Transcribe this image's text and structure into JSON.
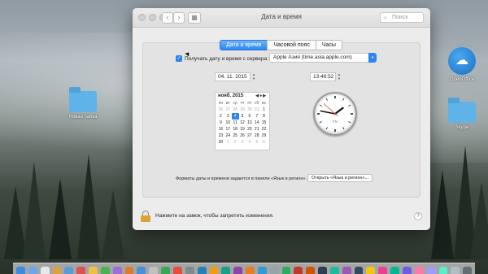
{
  "window": {
    "title": "Дата и время",
    "search_placeholder": "Поиск"
  },
  "tabs": [
    {
      "label": "Дата и время",
      "active": true
    },
    {
      "label": "Часовой пояс",
      "active": false
    },
    {
      "label": "Часы",
      "active": false
    }
  ],
  "server": {
    "checkbox_label": "Получать дату и время с сервера:",
    "checked": true,
    "selected": "Apple Азия (time.asia.apple.com)"
  },
  "date_field": "04. 11. 2015",
  "time_field": "13:46:52",
  "calendar": {
    "month_label": "нояб. 2015",
    "weekdays": [
      "пн",
      "вт",
      "ср",
      "чт",
      "пт",
      "сб",
      "вс"
    ],
    "days": [
      {
        "d": "26",
        "other": true
      },
      {
        "d": "27",
        "other": true
      },
      {
        "d": "28",
        "other": true
      },
      {
        "d": "29",
        "other": true
      },
      {
        "d": "30",
        "other": true
      },
      {
        "d": "31",
        "other": true
      },
      {
        "d": "1"
      },
      {
        "d": "2"
      },
      {
        "d": "3"
      },
      {
        "d": "4",
        "selected": true
      },
      {
        "d": "5"
      },
      {
        "d": "6"
      },
      {
        "d": "7"
      },
      {
        "d": "8"
      },
      {
        "d": "9"
      },
      {
        "d": "10"
      },
      {
        "d": "11"
      },
      {
        "d": "12"
      },
      {
        "d": "13"
      },
      {
        "d": "14"
      },
      {
        "d": "15"
      },
      {
        "d": "16"
      },
      {
        "d": "17"
      },
      {
        "d": "18"
      },
      {
        "d": "19"
      },
      {
        "d": "20"
      },
      {
        "d": "21"
      },
      {
        "d": "22"
      },
      {
        "d": "23"
      },
      {
        "d": "24"
      },
      {
        "d": "25"
      },
      {
        "d": "26"
      },
      {
        "d": "27"
      },
      {
        "d": "28"
      },
      {
        "d": "29"
      },
      {
        "d": "30"
      },
      {
        "d": "1",
        "other": true
      },
      {
        "d": "2",
        "other": true
      },
      {
        "d": "3",
        "other": true
      },
      {
        "d": "4",
        "other": true
      },
      {
        "d": "5",
        "other": true
      },
      {
        "d": "6",
        "other": true
      }
    ]
  },
  "clock": {
    "hour": 13,
    "minute": 46,
    "second": 52,
    "ampm_label": "PM"
  },
  "formats": {
    "text": "Форматы даты и времени задаются в панели «Язык и регион».",
    "button_label": "Открыть «Язык и регион»..."
  },
  "lock_text": "Нажмите на замок, чтобы запретить изменения.",
  "help_label": "?",
  "desktop": {
    "folder_label": "Новая папка",
    "openoffice_label": "OpenOffice",
    "skype_label": "Skype"
  },
  "colors": {
    "accent": "#2c86f2",
    "lock": "#d8a437"
  },
  "dock_colors": [
    "#3b8be0",
    "#6fa7e6",
    "#e8e8e8",
    "#e0a040",
    "#5b9bd5",
    "#d9534f",
    "#f0c040",
    "#4caf50",
    "#9c6fd6",
    "#e07a30",
    "#4a90d9",
    "#c0c0c0",
    "#3aa655",
    "#e74c3c",
    "#7f8c8d",
    "#2980b9",
    "#f39c12",
    "#16a085",
    "#8e44ad",
    "#e67e22",
    "#3498db",
    "#95a5a6",
    "#27ae60",
    "#c0392b",
    "#d35400",
    "#2c3e50",
    "#1abc9c",
    "#9b59b6",
    "#34495e",
    "#f1c40f",
    "#e84393",
    "#00b894",
    "#6c5ce7",
    "#fd79a8",
    "#a29bfe",
    "#55efc4",
    "#b2bec3",
    "#636e72"
  ]
}
